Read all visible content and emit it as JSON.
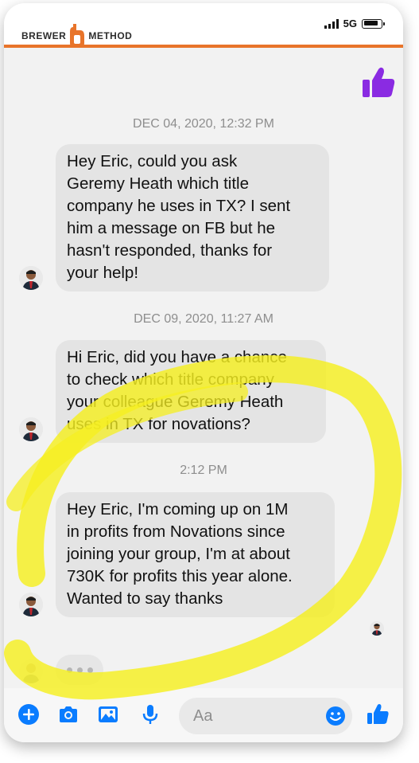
{
  "status_bar": {
    "brand_left": "BREWER",
    "brand_right": "METHOD",
    "network": "5G"
  },
  "conversation": [
    {
      "type": "timestamp",
      "text": "DEC 04, 2020, 12:32 PM"
    },
    {
      "type": "message",
      "text": "Hey Eric, could you ask\nGeremy Heath which title\ncompany he uses in TX? I sent\nhim a message on FB but he\nhasn't responded, thanks for\nyour help!"
    },
    {
      "type": "timestamp",
      "text": "DEC 09, 2020, 11:27 AM"
    },
    {
      "type": "message",
      "text": "Hi Eric, did you have a chance\nto check which title company\nyour colleague Geremy Heath\nuses in TX for novations?"
    },
    {
      "type": "timestamp",
      "text": "2:12 PM"
    },
    {
      "type": "message",
      "text": "Hey Eric, I'm coming up on 1M\nin profits from Novations since\njoining your group, I'm at about\n730K for profits this year alone.\nWanted to say thanks"
    }
  ],
  "composer": {
    "placeholder": "Aa"
  },
  "colors": {
    "brand_orange": "#e8742a",
    "messenger_blue": "#0a7cff",
    "like_purple": "#8a2be2",
    "highlight_yellow": "#f5ef20"
  }
}
